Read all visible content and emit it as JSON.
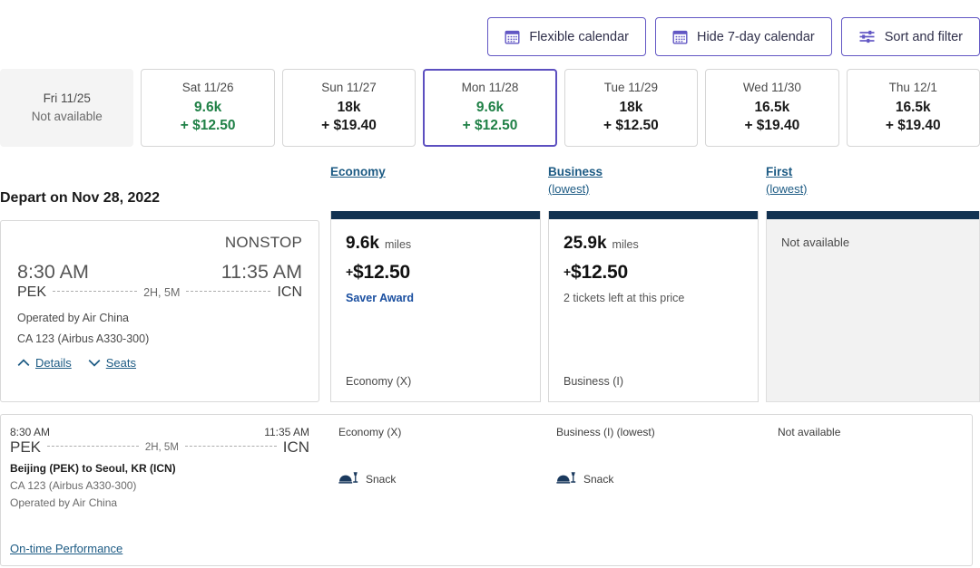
{
  "toolbar": {
    "buttons": [
      {
        "label": "Flexible calendar",
        "icon": "calendar-icon"
      },
      {
        "label": "Hide 7-day calendar",
        "icon": "calendar-icon"
      },
      {
        "label": "Sort and filter",
        "icon": "sliders-icon"
      }
    ]
  },
  "accent_color": "#6257c4",
  "cheap_color": "#1f8046",
  "link_color": "#1d5b84",
  "navy_color": "#123251",
  "date_strip": [
    {
      "date": "Fri 11/25",
      "status": "Not available",
      "available": false,
      "selected": false,
      "cheapest": false
    },
    {
      "date": "Sat 11/26",
      "miles": "9.6k",
      "price": "+ $12.50",
      "available": true,
      "selected": false,
      "cheapest": true
    },
    {
      "date": "Sun 11/27",
      "miles": "18k",
      "price": "+ $19.40",
      "available": true,
      "selected": false,
      "cheapest": false
    },
    {
      "date": "Mon 11/28",
      "miles": "9.6k",
      "price": "+ $12.50",
      "available": true,
      "selected": true,
      "cheapest": true
    },
    {
      "date": "Tue 11/29",
      "miles": "18k",
      "price": "+ $12.50",
      "available": true,
      "selected": false,
      "cheapest": false
    },
    {
      "date": "Wed 11/30",
      "miles": "16.5k",
      "price": "+ $19.40",
      "available": true,
      "selected": false,
      "cheapest": false
    },
    {
      "date": "Thu 12/1",
      "miles": "16.5k",
      "price": "+ $19.40",
      "available": true,
      "selected": false,
      "cheapest": false
    }
  ],
  "cabin_headers": [
    {
      "label": "Economy",
      "sub": ""
    },
    {
      "label": "Business",
      "sub": "(lowest)"
    },
    {
      "label": "First",
      "sub": "(lowest)"
    }
  ],
  "depart_title": "Depart on Nov 28, 2022",
  "flight": {
    "stops": "NONSTOP",
    "depart_time": "8:30 AM",
    "arrive_time": "11:35 AM",
    "origin": "PEK",
    "destination": "ICN",
    "duration": "2H, 5M",
    "operated_by": "Operated by Air China",
    "aircraft": "CA 123 (Airbus A330-300)",
    "details_link": "Details",
    "seats_link": "Seats"
  },
  "fares": [
    {
      "cabin": "economy",
      "miles": "9.6k",
      "miles_unit": "miles",
      "price": "$12.50",
      "price_prefix": "+",
      "note": "Saver Award",
      "note_style": "saver",
      "class_label": "Economy (X)",
      "available": true
    },
    {
      "cabin": "business",
      "miles": "25.9k",
      "miles_unit": "miles",
      "price": "$12.50",
      "price_prefix": "+",
      "note": "2 tickets left at this price",
      "note_style": "plain",
      "class_label": "Business (I)",
      "available": true
    },
    {
      "cabin": "first",
      "unavailable_text": "Not available",
      "available": false
    }
  ],
  "details_panel": {
    "segment": {
      "depart_time": "8:30 AM",
      "arrive_time": "11:35 AM",
      "origin": "PEK",
      "destination": "ICN",
      "duration": "2H, 5M",
      "city_pair": "Beijing (PEK) to Seoul, KR (ICN)",
      "aircraft": "CA 123 (Airbus A330-300)",
      "operated_by": "Operated by Air China"
    },
    "on_time_link": "On-time Performance",
    "columns": [
      {
        "cabin_label": "Economy (X)",
        "amenity": "Snack",
        "amenity_icon": "meal-icon",
        "available": true
      },
      {
        "cabin_label": "Business (I) (lowest)",
        "amenity": "Snack",
        "amenity_icon": "meal-icon",
        "available": true
      },
      {
        "cabin_label": "Not available",
        "available": false
      }
    ]
  }
}
